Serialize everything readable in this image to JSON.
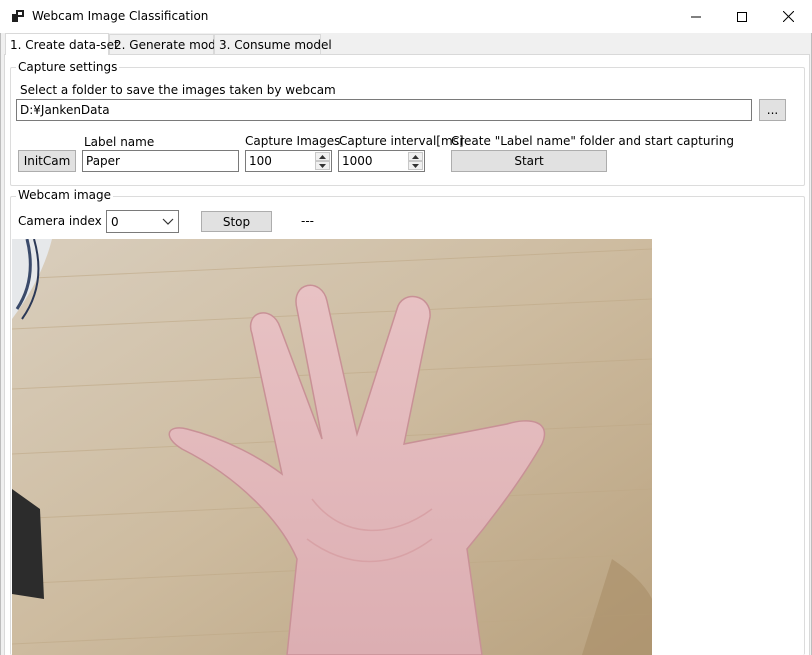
{
  "window": {
    "title": "Webcam Image Classification"
  },
  "tabs": [
    {
      "label": "1. Create data-set",
      "active": true
    },
    {
      "label": "2. Generate model",
      "active": false
    },
    {
      "label": "3. Consume model",
      "active": false
    }
  ],
  "capture_settings": {
    "group_title": "Capture settings",
    "folder_prompt": "Select a folder to save the images taken by webcam",
    "folder_path": "D:¥JankenData",
    "browse_label": "...",
    "initcam_label": "InitCam",
    "label_name_caption": "Label name",
    "label_name_value": "Paper",
    "capture_images_caption": "Capture Images",
    "capture_images_value": "100",
    "capture_interval_caption": "Capture interval[ms]",
    "capture_interval_value": "1000",
    "start_caption": "Create \"Label name\" folder and start capturing",
    "start_label": "Start"
  },
  "webcam": {
    "group_title": "Webcam image",
    "camera_index_label": "Camera index",
    "camera_index_value": "0",
    "stop_label": "Stop",
    "status_text": "---"
  }
}
